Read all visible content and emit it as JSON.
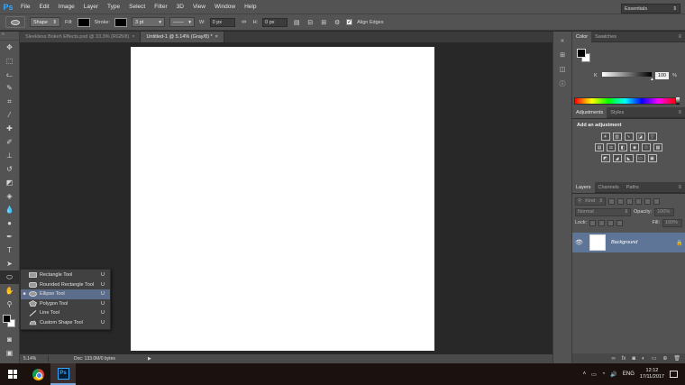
{
  "menubar": {
    "logo": "Ps",
    "items": [
      "File",
      "Edit",
      "Image",
      "Layer",
      "Type",
      "Select",
      "Filter",
      "3D",
      "View",
      "Window",
      "Help"
    ],
    "controls": [
      "–",
      "☐",
      "✕"
    ]
  },
  "options_bar": {
    "mode": "Shape",
    "fill_label": "Fill:",
    "stroke_label": "Stroke:",
    "stroke_width": "3 pt",
    "w_label": "W:",
    "w_value": "0 px",
    "h_label": "H:",
    "h_value": "0 px",
    "align_edges": "Align Edges",
    "workspace": "Essentials"
  },
  "document_tabs": [
    {
      "label": "Sleekless Bokeh Effects.psd @ 33.3% (RGB/8)",
      "close": "×",
      "active": false
    },
    {
      "label": "Untitled-1 @ 5.14% (Gray/8) *",
      "close": "×",
      "active": true
    }
  ],
  "statusbar": {
    "zoom": "5.14%",
    "doc": "Doc: 133.0M/0 bytes",
    "arrow": "▶"
  },
  "tool_flyout": {
    "items": [
      {
        "label": "Rectangle Tool",
        "key": "U",
        "icon": "rectangle-tool-icon",
        "selected": false
      },
      {
        "label": "Rounded Rectangle Tool",
        "key": "U",
        "icon": "rounded-rectangle-tool-icon",
        "selected": false
      },
      {
        "label": "Ellipse Tool",
        "key": "U",
        "icon": "ellipse-tool-icon",
        "selected": true
      },
      {
        "label": "Polygon Tool",
        "key": "U",
        "icon": "polygon-tool-icon",
        "selected": false
      },
      {
        "label": "Line Tool",
        "key": "U",
        "icon": "line-tool-icon",
        "selected": false
      },
      {
        "label": "Custom Shape Tool",
        "key": "U",
        "icon": "custom-shape-tool-icon",
        "selected": false
      }
    ]
  },
  "color_panel": {
    "tabs": [
      "Color",
      "Swatches"
    ],
    "channel": "K",
    "value": "100",
    "unit": "%"
  },
  "adjustments_panel": {
    "tabs": [
      "Adjustments",
      "Styles"
    ],
    "title": "Add an adjustment"
  },
  "layers_panel": {
    "tabs": [
      "Layers",
      "Channels",
      "Paths"
    ],
    "filter": "Kind",
    "blend_mode": "Normal",
    "opacity_label": "Opacity:",
    "opacity_value": "100%",
    "lock_label": "Lock:",
    "fill_label": "Fill:",
    "fill_value": "100%",
    "layer_name": "Background"
  },
  "taskbar": {
    "language": "ENG",
    "time": "12:12",
    "date": "17/11/2017"
  },
  "colors": {
    "menu_bg": "#535353",
    "canvas_bg": "#282828",
    "selected_layer": "#5e7597",
    "flyout_selected": "#5b6d8b",
    "taskbar": "#1b120f"
  }
}
